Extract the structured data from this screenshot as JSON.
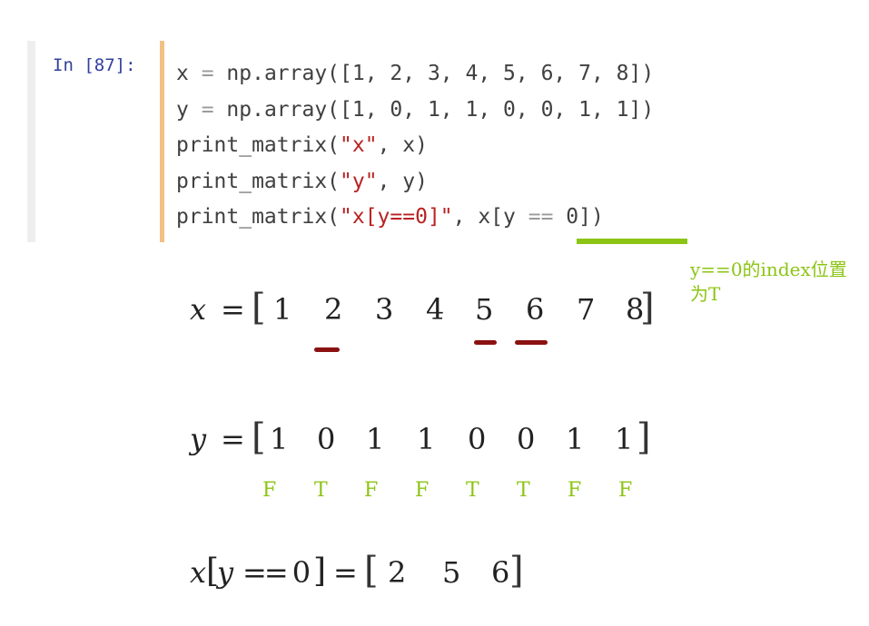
{
  "cell": {
    "prompt": "In [87]:",
    "code_lines": [
      [
        {
          "t": "x ",
          "c": ""
        },
        {
          "t": "=",
          "c": "op"
        },
        {
          "t": " np.array([1, 2, 3, 4, 5, 6, 7, 8])",
          "c": ""
        }
      ],
      [
        {
          "t": "y ",
          "c": ""
        },
        {
          "t": "=",
          "c": "op"
        },
        {
          "t": " np.array([1, 0, 1, 1, 0, 0, 1, 1])",
          "c": ""
        }
      ],
      [
        {
          "t": "print_matrix(",
          "c": ""
        },
        {
          "t": "\"x\"",
          "c": "str"
        },
        {
          "t": ", x)",
          "c": ""
        }
      ],
      [
        {
          "t": "print_matrix(",
          "c": ""
        },
        {
          "t": "\"y\"",
          "c": "str"
        },
        {
          "t": ", y)",
          "c": ""
        }
      ],
      [
        {
          "t": "print_matrix(",
          "c": ""
        },
        {
          "t": "\"x[y==0]\"",
          "c": "str"
        },
        {
          "t": ", x[y ",
          "c": ""
        },
        {
          "t": "==",
          "c": "op"
        },
        {
          "t": " 0])",
          "c": ""
        }
      ]
    ]
  },
  "annotation": {
    "note": "y==0的index位置为T",
    "color": "#8cc414"
  },
  "math": {
    "x_label": "x",
    "x_values": [
      "1",
      "2",
      "3",
      "4",
      "5",
      "6",
      "7",
      "8"
    ],
    "y_label": "y",
    "y_values": [
      "1",
      "0",
      "1",
      "1",
      "0",
      "0",
      "1",
      "1"
    ],
    "tf_values": [
      "F",
      "T",
      "F",
      "F",
      "T",
      "T",
      "F",
      "F"
    ],
    "result_label_x": "x",
    "result_label_y": "y",
    "result_cond": "== 0",
    "result_values": [
      "2",
      "5",
      "6"
    ]
  }
}
